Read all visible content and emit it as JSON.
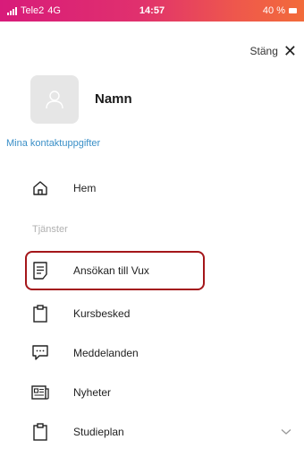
{
  "status_bar": {
    "carrier": "Tele2",
    "network": "4G",
    "time": "14:57",
    "battery": "40 %"
  },
  "header": {
    "close_label": "Stäng",
    "close_icon": "close-icon"
  },
  "profile": {
    "name": "Namn",
    "contact_link": "Mina kontaktuppgifter"
  },
  "menu": {
    "home": {
      "label": "Hem",
      "icon": "home-icon"
    },
    "section_label": "Tjänster",
    "services": [
      {
        "label": "Ansökan till Vux",
        "icon": "form-icon",
        "highlighted": true
      },
      {
        "label": "Kursbesked",
        "icon": "clipboard-icon"
      },
      {
        "label": "Meddelanden",
        "icon": "message-icon"
      },
      {
        "label": "Nyheter",
        "icon": "news-icon"
      },
      {
        "label": "Studieplan",
        "icon": "clipboard-icon",
        "expandable": true
      }
    ]
  },
  "colors": {
    "status_gradient_start": "#d81b7a",
    "status_gradient_end": "#f26b3a",
    "link": "#3a8fc7",
    "highlight_border": "#a4161a"
  }
}
